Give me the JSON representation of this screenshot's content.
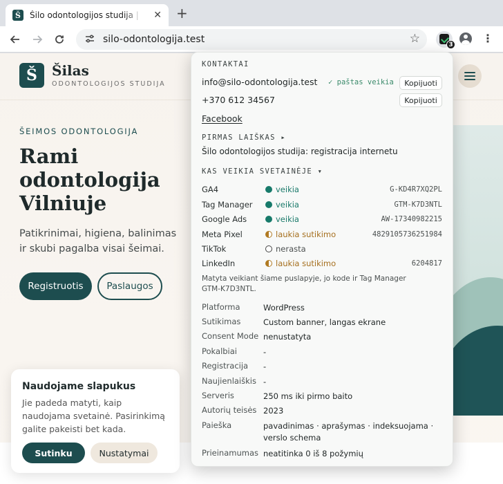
{
  "browser": {
    "tab_title": "Šilo odontologijos studija | Odontologija",
    "favicon_letter": "Š",
    "url": "silo-odontologija.test",
    "extension_badge": "3"
  },
  "site": {
    "logo_letter": "Š",
    "logo_name": "Šilas",
    "logo_sub": "ODONTOLOGIJOS STUDIJA",
    "eyebrow": "ŠEIMOS ODONTOLOGIJA",
    "hero_title": "Rami odontologija Vilniuje",
    "hero_text": "Patikrinimai, higiena, balinimas ir skubi pagalba visai šeimai.",
    "btn_register": "Registruotis",
    "btn_services": "Paslaugos"
  },
  "cookie": {
    "title": "Naudojame slapukus",
    "text": "Jie padeda matyti, kaip naudojama svetainė. Pasirinkimą galite pakeisti bet kada.",
    "accept": "Sutinku",
    "settings": "Nustatymai"
  },
  "popup": {
    "contacts_heading": "KONTAKTAI",
    "email": "info@silo-odontologija.test",
    "email_status": "✓ paštas veikia",
    "copy_label": "Kopijuoti",
    "phone": "+370 612 34567",
    "facebook": "Facebook",
    "first_letter_heading": "PIRMAS LAIŠKAS ▸",
    "first_letter_text": "Šilo odontologijos studija: registracija internetu",
    "trackers_heading": "KAS VEIKIA SVETAINĖJE ▾",
    "trackers": [
      {
        "name": "GA4",
        "status": "veikia",
        "state": "ok",
        "id": "G-KD4R7XQ2PL"
      },
      {
        "name": "Tag Manager",
        "status": "veikia",
        "state": "ok",
        "id": "GTM-K7D3NTL"
      },
      {
        "name": "Google Ads",
        "status": "veikia",
        "state": "ok",
        "id": "AW-17340982215"
      },
      {
        "name": "Meta Pixel",
        "status": "laukia sutikimo",
        "state": "wait",
        "id": "4829105736251984"
      },
      {
        "name": "TikTok",
        "status": "nerasta",
        "state": "none",
        "id": ""
      },
      {
        "name": "LinkedIn",
        "status": "laukia sutikimo",
        "state": "wait",
        "id": "6204817"
      }
    ],
    "note": "Matyta veikiant šiame puslapyje, jo kode ir Tag Manager GTM-K7D3NTL.",
    "info": [
      {
        "key": "Platforma",
        "value": "WordPress"
      },
      {
        "key": "Sutikimas",
        "value": "Custom banner, langas ekrane"
      },
      {
        "key": "Consent Mode",
        "value": "nenustatyta"
      },
      {
        "key": "Pokalbiai",
        "value": "-"
      },
      {
        "key": "Registracija",
        "value": "-"
      },
      {
        "key": "Naujienlaiškis",
        "value": "-"
      },
      {
        "key": "Serveris",
        "value": "250 ms iki pirmo baito"
      },
      {
        "key": "Autorių teisės",
        "value": "2023"
      },
      {
        "key": "Paieška",
        "value": "pavadinimas · aprašymas · indeksuojama · verslo schema"
      },
      {
        "key": "Prieinamumas",
        "value": "neatitinka 0 iš 8 požymių"
      }
    ]
  }
}
